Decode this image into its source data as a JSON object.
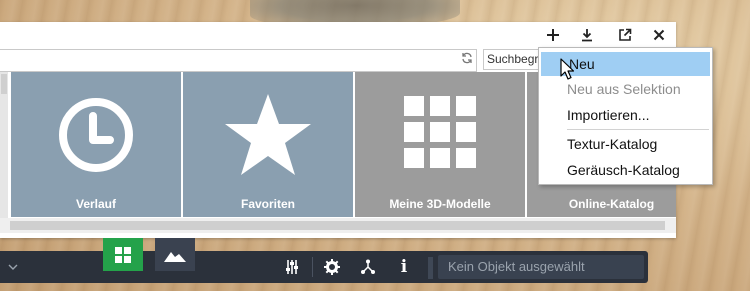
{
  "toolbar": {
    "icons": [
      "plus-icon",
      "download-icon",
      "external-link-icon",
      "close-icon"
    ]
  },
  "pathbar": {
    "value": ""
  },
  "search": {
    "placeholder": "Suchbegr"
  },
  "tiles": [
    {
      "label": "Verlauf",
      "icon": "clock-icon",
      "color": "#8a9fb0"
    },
    {
      "label": "Favoriten",
      "icon": "star-icon",
      "color": "#8a9fb0"
    },
    {
      "label": "Meine 3D-Modelle",
      "icon": "grid-icon",
      "color": "#9c9c9c"
    },
    {
      "label": "Online-Katalog",
      "icon": "",
      "color": "#9c9c9c"
    }
  ],
  "menu": {
    "items": [
      {
        "label": "Neu",
        "state": "highlighted"
      },
      {
        "label": "Neu aus Selektion",
        "state": "disabled"
      },
      {
        "label": "Importieren...",
        "state": "normal"
      },
      {
        "label": "Textur-Katalog",
        "state": "normal"
      },
      {
        "label": "Geräusch-Katalog",
        "state": "normal"
      }
    ]
  },
  "bottombar": {
    "status": "Kein Objekt ausgewählt",
    "colors": {
      "bar": "#2b313b",
      "green": "#24a24a"
    }
  }
}
